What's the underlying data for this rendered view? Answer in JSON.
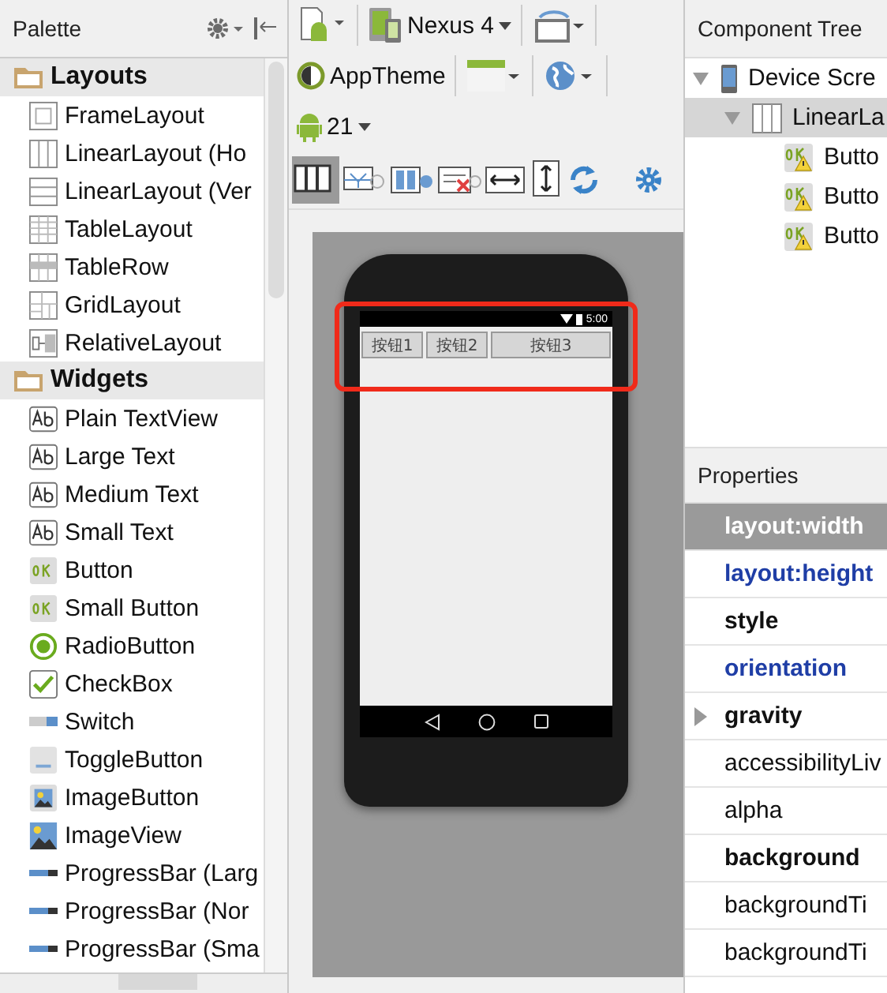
{
  "palette": {
    "title": "Palette",
    "groups": [
      {
        "label": "Layouts",
        "items": [
          {
            "label": "FrameLayout",
            "kind": "frame"
          },
          {
            "label": "LinearLayout (Ho",
            "kind": "linear-h"
          },
          {
            "label": "LinearLayout (Ver",
            "kind": "linear-v"
          },
          {
            "label": "TableLayout",
            "kind": "table"
          },
          {
            "label": "TableRow",
            "kind": "tablerow"
          },
          {
            "label": "GridLayout",
            "kind": "grid"
          },
          {
            "label": "RelativeLayout",
            "kind": "relative"
          }
        ]
      },
      {
        "label": "Widgets",
        "items": [
          {
            "label": "Plain TextView",
            "kind": "text"
          },
          {
            "label": "Large Text",
            "kind": "text"
          },
          {
            "label": "Medium Text",
            "kind": "text"
          },
          {
            "label": "Small Text",
            "kind": "text"
          },
          {
            "label": "Button",
            "kind": "button"
          },
          {
            "label": "Small Button",
            "kind": "button"
          },
          {
            "label": "RadioButton",
            "kind": "radio"
          },
          {
            "label": "CheckBox",
            "kind": "checkbox"
          },
          {
            "label": "Switch",
            "kind": "switch"
          },
          {
            "label": "ToggleButton",
            "kind": "toggle"
          },
          {
            "label": "ImageButton",
            "kind": "imagebutton"
          },
          {
            "label": "ImageView",
            "kind": "imageview"
          },
          {
            "label": "ProgressBar (Larg",
            "kind": "progress"
          },
          {
            "label": "ProgressBar (Nor",
            "kind": "progress"
          },
          {
            "label": "ProgressBar (Sma",
            "kind": "progress"
          }
        ]
      }
    ]
  },
  "toolbar": {
    "device": "Nexus 4",
    "theme": "AppTheme",
    "api": "21"
  },
  "preview": {
    "status_time": "5:00",
    "buttons": [
      "按钮1",
      "按钮2",
      "按钮3"
    ],
    "highlighted": true
  },
  "tree": {
    "title": "Component Tree",
    "nodes": [
      {
        "label": "Device Scre",
        "kind": "device",
        "expanded": true,
        "selected": false,
        "children": [
          {
            "label": "LinearLa",
            "kind": "linear",
            "expanded": true,
            "selected": true,
            "children": [
              {
                "label": "Butto",
                "kind": "button",
                "selected": false
              },
              {
                "label": "Butto",
                "kind": "button",
                "selected": false
              },
              {
                "label": "Butto",
                "kind": "button",
                "selected": false
              }
            ]
          }
        ]
      }
    ]
  },
  "properties": {
    "title": "Properties",
    "rows": [
      {
        "name": "layout:width",
        "kind": "set",
        "selected": true,
        "expandable": false
      },
      {
        "name": "layout:height",
        "kind": "set",
        "selected": false,
        "expandable": false
      },
      {
        "name": "style",
        "kind": "important",
        "selected": false,
        "expandable": false
      },
      {
        "name": "orientation",
        "kind": "set",
        "selected": false,
        "expandable": false
      },
      {
        "name": "gravity",
        "kind": "important",
        "selected": false,
        "expandable": true
      },
      {
        "name": "accessibilityLiv",
        "kind": "plain",
        "selected": false,
        "expandable": false
      },
      {
        "name": "alpha",
        "kind": "plain",
        "selected": false,
        "expandable": false
      },
      {
        "name": "background",
        "kind": "important",
        "selected": false,
        "expandable": false
      },
      {
        "name": "backgroundTi",
        "kind": "plain",
        "selected": false,
        "expandable": false
      },
      {
        "name": "backgroundTi",
        "kind": "plain",
        "selected": false,
        "expandable": false
      }
    ]
  }
}
